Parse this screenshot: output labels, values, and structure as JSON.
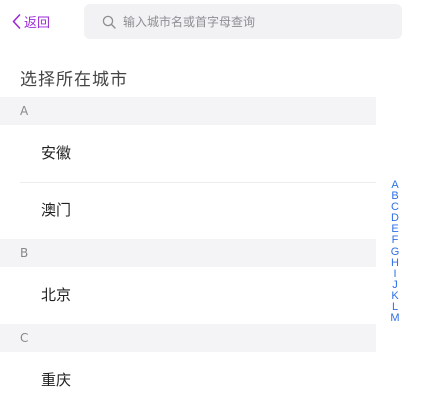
{
  "header": {
    "back_label": "返回",
    "search_placeholder": "输入城市名或首字母查询"
  },
  "page_title": "选择所在城市",
  "sections": [
    {
      "letter": "A",
      "cities": [
        "安徽",
        "澳门"
      ]
    },
    {
      "letter": "B",
      "cities": [
        "北京"
      ]
    },
    {
      "letter": "C",
      "cities": [
        "重庆"
      ]
    }
  ],
  "index_letters": [
    "A",
    "B",
    "C",
    "D",
    "E",
    "F",
    "G",
    "H",
    "I",
    "J",
    "K",
    "L",
    "M"
  ],
  "colors": {
    "accent_back": "#9a2bd6",
    "index_blue": "#2f6fe8",
    "section_bg": "#f4f4f6"
  }
}
